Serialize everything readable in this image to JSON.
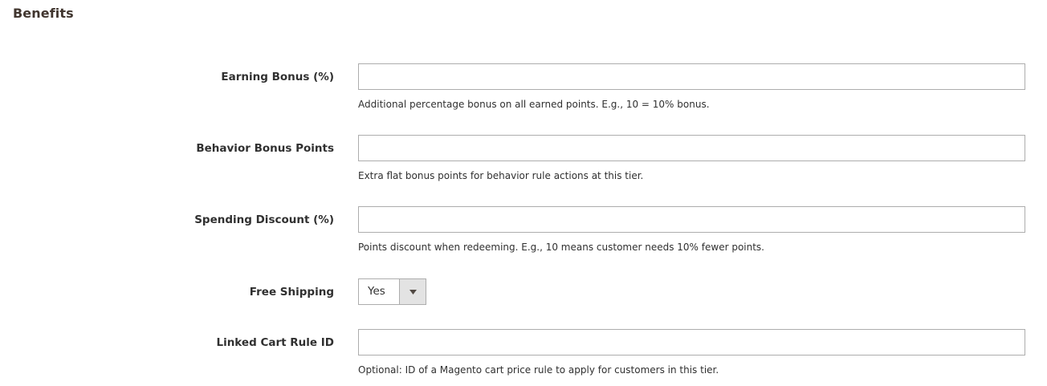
{
  "section": {
    "title": "Benefits"
  },
  "fields": {
    "earning_bonus": {
      "label": "Earning Bonus (%)",
      "value": "",
      "note": "Additional percentage bonus on all earned points. E.g., 10 = 10% bonus."
    },
    "behavior_bonus_points": {
      "label": "Behavior Bonus Points",
      "value": "",
      "note": "Extra flat bonus points for behavior rule actions at this tier."
    },
    "spending_discount": {
      "label": "Spending Discount (%)",
      "value": "",
      "note": "Points discount when redeeming. E.g., 10 means customer needs 10% fewer points."
    },
    "free_shipping": {
      "label": "Free Shipping",
      "selected": "Yes",
      "arrow_icon": "triangle-down-icon"
    },
    "linked_cart_rule_id": {
      "label": "Linked Cart Rule ID",
      "value": "",
      "note": "Optional: ID of a Magento cart price rule to apply for customers in this tier."
    }
  }
}
